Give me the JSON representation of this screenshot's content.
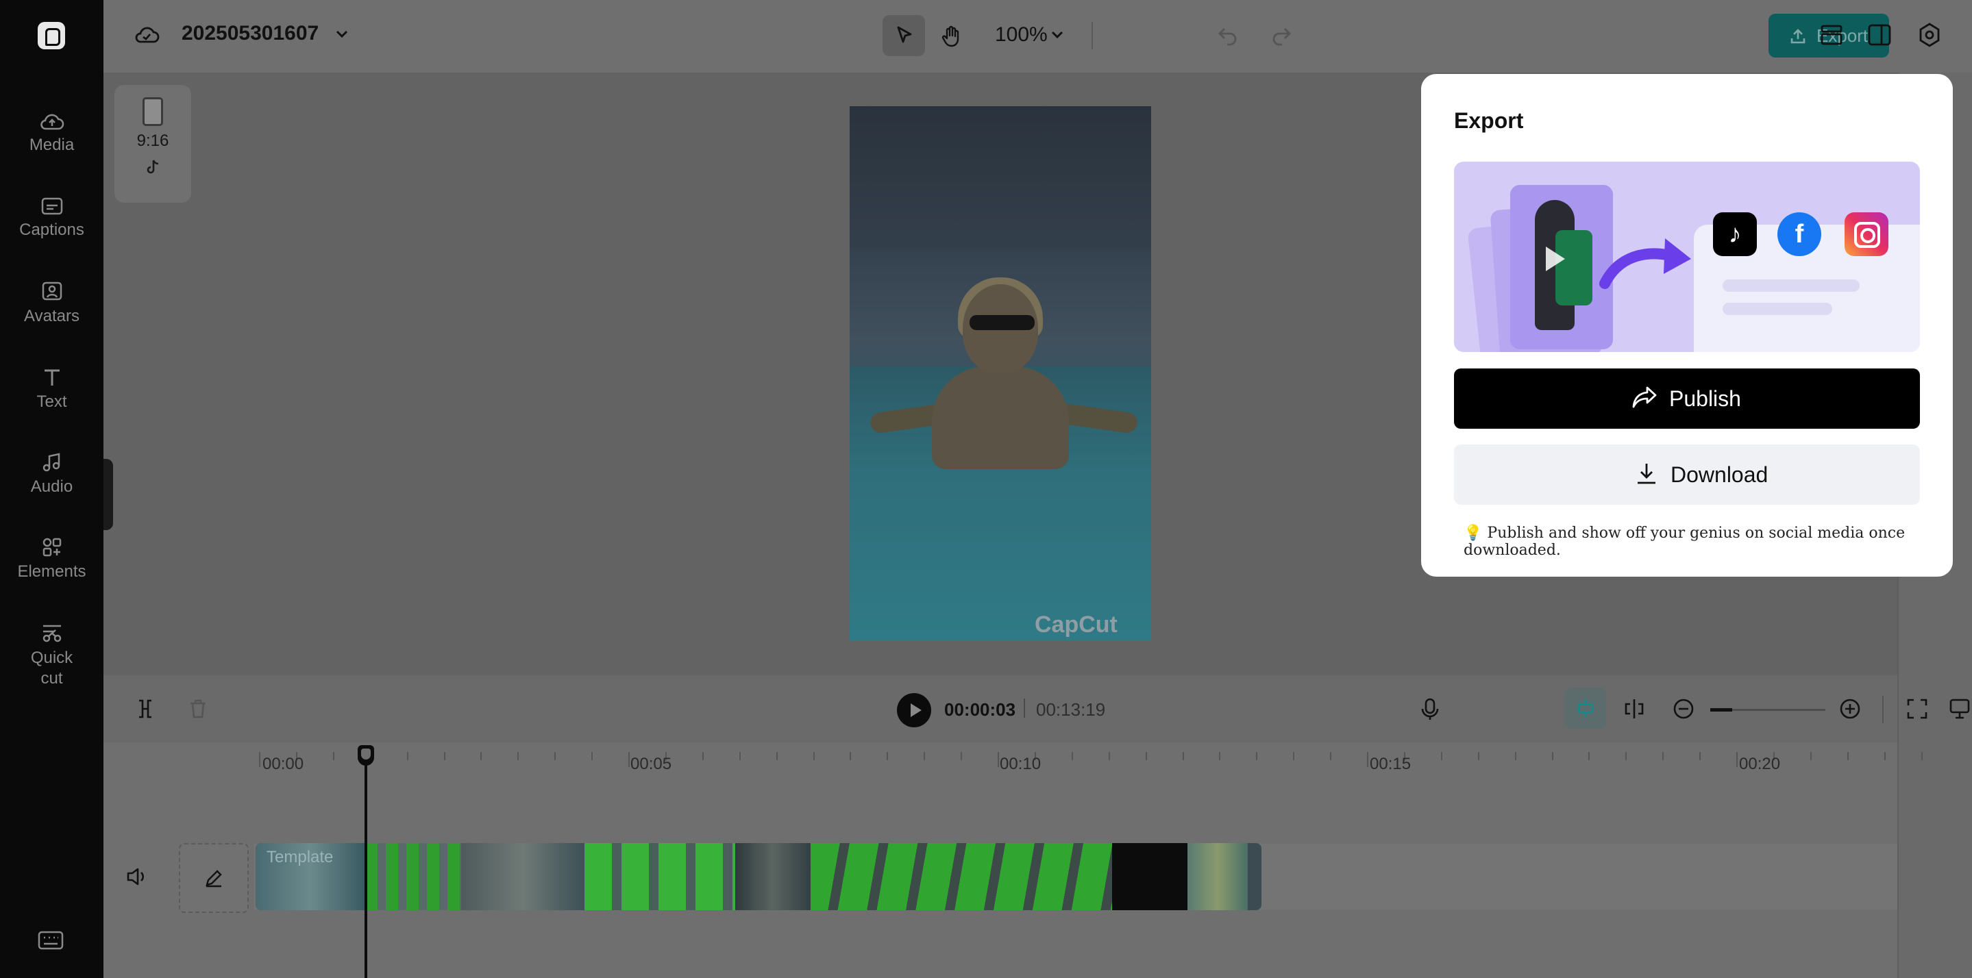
{
  "sidebar": {
    "items": [
      {
        "label": "Media",
        "icon": "cloud-upload-icon"
      },
      {
        "label": "Captions",
        "icon": "captions-icon"
      },
      {
        "label": "Avatars",
        "icon": "avatar-icon"
      },
      {
        "label": "Text",
        "icon": "text-icon"
      },
      {
        "label": "Audio",
        "icon": "music-note-icon"
      },
      {
        "label": "Elements",
        "icon": "elements-icon"
      },
      {
        "label": "Quick cut",
        "icon": "scissors-icon"
      }
    ]
  },
  "topbar": {
    "project_name": "202505301607",
    "zoom": "100%",
    "export_label": "Export"
  },
  "canvas": {
    "ratio_label": "9:16",
    "watermark": "CapCut"
  },
  "playback": {
    "current_time": "00:00:03",
    "total_time": "00:13:19"
  },
  "timeline": {
    "ticks": [
      "00:00",
      "00:05",
      "00:10",
      "00:15",
      "00:20"
    ],
    "clip_label": "Template"
  },
  "export_popup": {
    "title": "Export",
    "publish_label": "Publish",
    "download_label": "Download",
    "tip": "💡 Publish and show off your genius on social media once downloaded.",
    "platforms": [
      "TikTok",
      "Facebook",
      "Instagram"
    ]
  },
  "colors": {
    "accent": "#0d8f8f",
    "sidebar_bg": "#0a0a0a",
    "overlay": "#6b6b6b"
  }
}
